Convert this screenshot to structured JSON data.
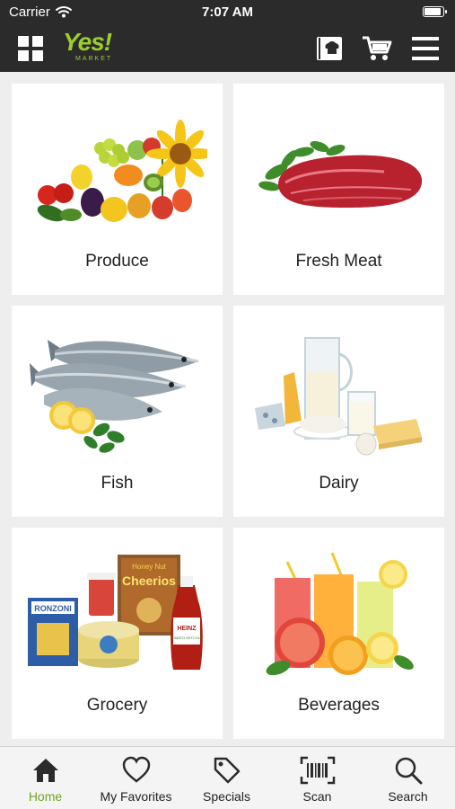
{
  "status_bar": {
    "carrier": "Carrier",
    "time": "7:07 AM",
    "battery_level": 0.95
  },
  "header": {
    "logo": {
      "text": "Yes!",
      "subtext": "MARKET"
    },
    "icons": [
      "grid-icon",
      "recipe-book-icon",
      "cart-icon",
      "menu-icon"
    ]
  },
  "categories": [
    {
      "label": "Produce",
      "icon": "produce-image"
    },
    {
      "label": "Fresh Meat",
      "icon": "fresh-meat-image"
    },
    {
      "label": "Fish",
      "icon": "fish-image"
    },
    {
      "label": "Dairy",
      "icon": "dairy-image"
    },
    {
      "label": "Grocery",
      "icon": "grocery-image"
    },
    {
      "label": "Beverages",
      "icon": "beverages-image"
    }
  ],
  "grocery_image_text": {
    "ronzoni": "RONZONI",
    "honey_nut": "Honey Nut",
    "cheerios": "Cheerios",
    "heinz": "HEINZ",
    "tomato_ketchup": "TOMATO KETCHUP"
  },
  "tab_bar": [
    {
      "label": "Home",
      "icon": "home-icon",
      "active": true
    },
    {
      "label": "My Favorites",
      "icon": "heart-icon",
      "active": false
    },
    {
      "label": "Specials",
      "icon": "tag-icon",
      "active": false
    },
    {
      "label": "Scan",
      "icon": "barcode-icon",
      "active": false
    },
    {
      "label": "Search",
      "icon": "search-icon",
      "active": false
    }
  ],
  "colors": {
    "brand_green": "#9ccd2f",
    "active_tab_green": "#6fa521",
    "header_background": "#2b2b2b",
    "grid_background": "#eeeeee"
  }
}
